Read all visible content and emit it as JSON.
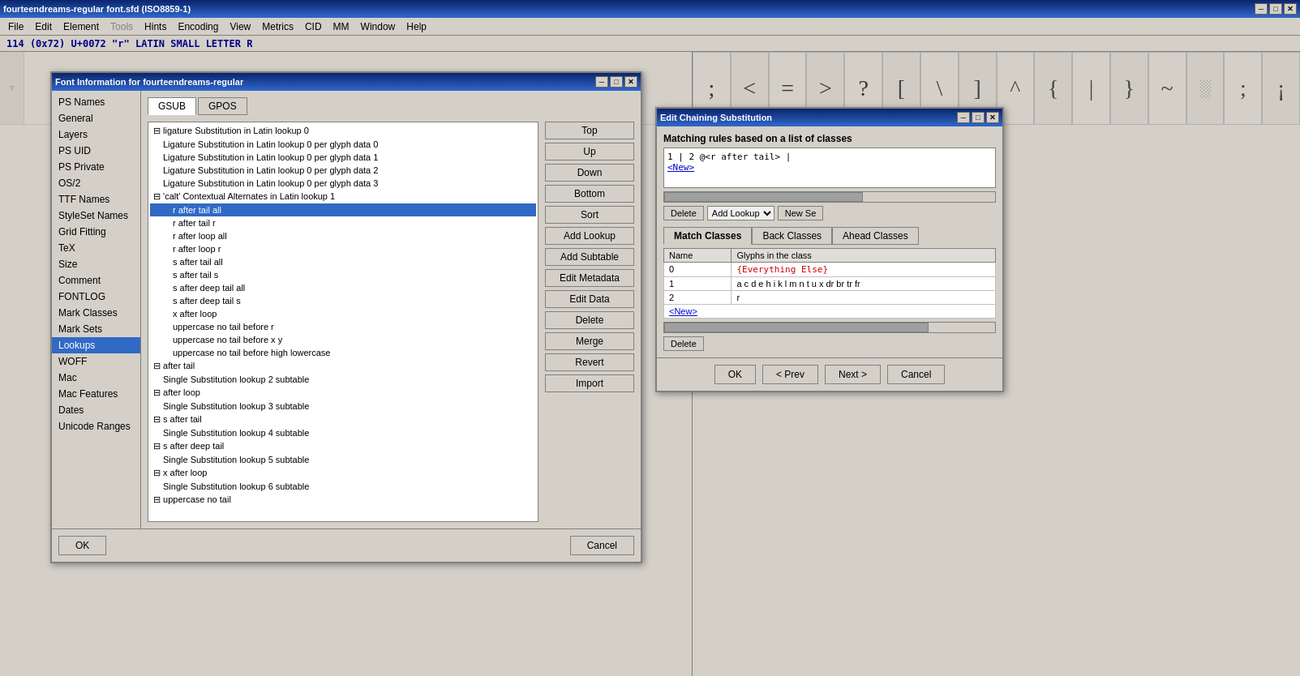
{
  "app": {
    "title": "fourteendreams-regular font.sfd (ISO8859-1)",
    "status": "114 (0x72) U+0072 \"r\" LATIN SMALL LETTER R"
  },
  "menu": {
    "items": [
      "File",
      "Edit",
      "Element",
      "Tools",
      "Hints",
      "Encoding",
      "View",
      "Metrics",
      "CID",
      "MM",
      "Window",
      "Help"
    ]
  },
  "font_info_dialog": {
    "title": "Font Information for fourteendreams-regular",
    "tabs": [
      "GSUB",
      "GPOS"
    ],
    "active_tab": "GSUB",
    "sidebar_items": [
      "PS Names",
      "General",
      "Layers",
      "PS UID",
      "PS Private",
      "OS/2",
      "TTF Names",
      "StyleSet Names",
      "Grid Fitting",
      "TeX",
      "Size",
      "Comment",
      "FONTLOG",
      "Mark Classes",
      "Mark Sets",
      "Lookups",
      "WOFF",
      "Mac",
      "Mac Features",
      "Dates",
      "Unicode Ranges"
    ],
    "active_sidebar": "Lookups",
    "lookup_items": [
      {
        "label": "⊟ ligature Substitution in Latin lookup 0",
        "indent": 0,
        "type": "collapse"
      },
      {
        "label": "Ligature Substitution in Latin lookup 0 per glyph data 0",
        "indent": 1
      },
      {
        "label": "Ligature Substitution in Latin lookup 0 per glyph data 1",
        "indent": 1
      },
      {
        "label": "Ligature Substitution in Latin lookup 0 per glyph data 2",
        "indent": 1
      },
      {
        "label": "Ligature Substitution in Latin lookup 0 per glyph data 3",
        "indent": 1
      },
      {
        "label": "⊟ 'calt' Contextual Alternates in Latin lookup 1",
        "indent": 0,
        "type": "collapse"
      },
      {
        "label": "r after tail all",
        "indent": 2,
        "selected": true
      },
      {
        "label": "r after tail r",
        "indent": 2
      },
      {
        "label": "r after loop all",
        "indent": 2
      },
      {
        "label": "r after loop r",
        "indent": 2
      },
      {
        "label": "s after tail all",
        "indent": 2
      },
      {
        "label": "s after tail s",
        "indent": 2
      },
      {
        "label": "s after deep tail all",
        "indent": 2
      },
      {
        "label": "s after deep tail s",
        "indent": 2
      },
      {
        "label": "x after loop",
        "indent": 2
      },
      {
        "label": "uppercase no tail before r",
        "indent": 2
      },
      {
        "label": "uppercase no tail before x y",
        "indent": 2
      },
      {
        "label": "uppercase no tail before high lowercase",
        "indent": 2
      },
      {
        "label": "⊟ after tail",
        "indent": 0,
        "type": "collapse"
      },
      {
        "label": "Single Substitution lookup 2 subtable",
        "indent": 1
      },
      {
        "label": "⊟ after loop",
        "indent": 0,
        "type": "collapse"
      },
      {
        "label": "Single Substitution lookup 3 subtable",
        "indent": 1
      },
      {
        "label": "⊟ s after tail",
        "indent": 0,
        "type": "collapse"
      },
      {
        "label": "Single Substitution lookup 4 subtable",
        "indent": 1
      },
      {
        "label": "⊟ s after deep tail",
        "indent": 0,
        "type": "collapse"
      },
      {
        "label": "Single Substitution lookup 5 subtable",
        "indent": 1
      },
      {
        "label": "⊟ x after loop",
        "indent": 0,
        "type": "collapse"
      },
      {
        "label": "Single Substitution lookup 6 subtable",
        "indent": 1
      },
      {
        "label": "⊟ uppercase no tail",
        "indent": 0,
        "type": "collapse"
      }
    ],
    "buttons": [
      "Top",
      "Up",
      "Down",
      "Bottom",
      "Sort",
      "Add Lookup",
      "Add Subtable",
      "Edit Metadata",
      "Edit Data",
      "Delete",
      "Merge",
      "Revert",
      "Import"
    ],
    "footer_buttons": [
      "OK",
      "Cancel"
    ]
  },
  "chain_dialog": {
    "title": "Edit Chaining Substitution",
    "matching_label": "Matching rules based on a list of classes",
    "rule_line1": "1 | 2 @<r after tail> |",
    "new_link": "<New>",
    "class_tabs": [
      "Match Classes",
      "Back Classes",
      "Ahead Classes"
    ],
    "active_class_tab": "Match Classes",
    "table_headers": [
      "Name",
      "Glyphs in the class"
    ],
    "table_rows": [
      {
        "name": "0",
        "glyphs": "{Everything Else}",
        "glyph_type": "code"
      },
      {
        "name": "1",
        "glyphs": "a c d e h i k l m n t u x dr br tr fr",
        "glyph_type": "normal"
      },
      {
        "name": "2",
        "glyphs": "r",
        "glyph_type": "normal"
      }
    ],
    "new_row_link": "<New>",
    "toolbar": {
      "delete_btn": "Delete",
      "add_lookup_btn": "Add Lookup",
      "new_se_btn": "New Se"
    },
    "footer_buttons": [
      "OK",
      "< Prev",
      "Next >",
      "Cancel"
    ]
  },
  "icons": {
    "minimize": "─",
    "maximize": "□",
    "close": "✕",
    "collapse": "⊟",
    "expand": "⊞"
  }
}
